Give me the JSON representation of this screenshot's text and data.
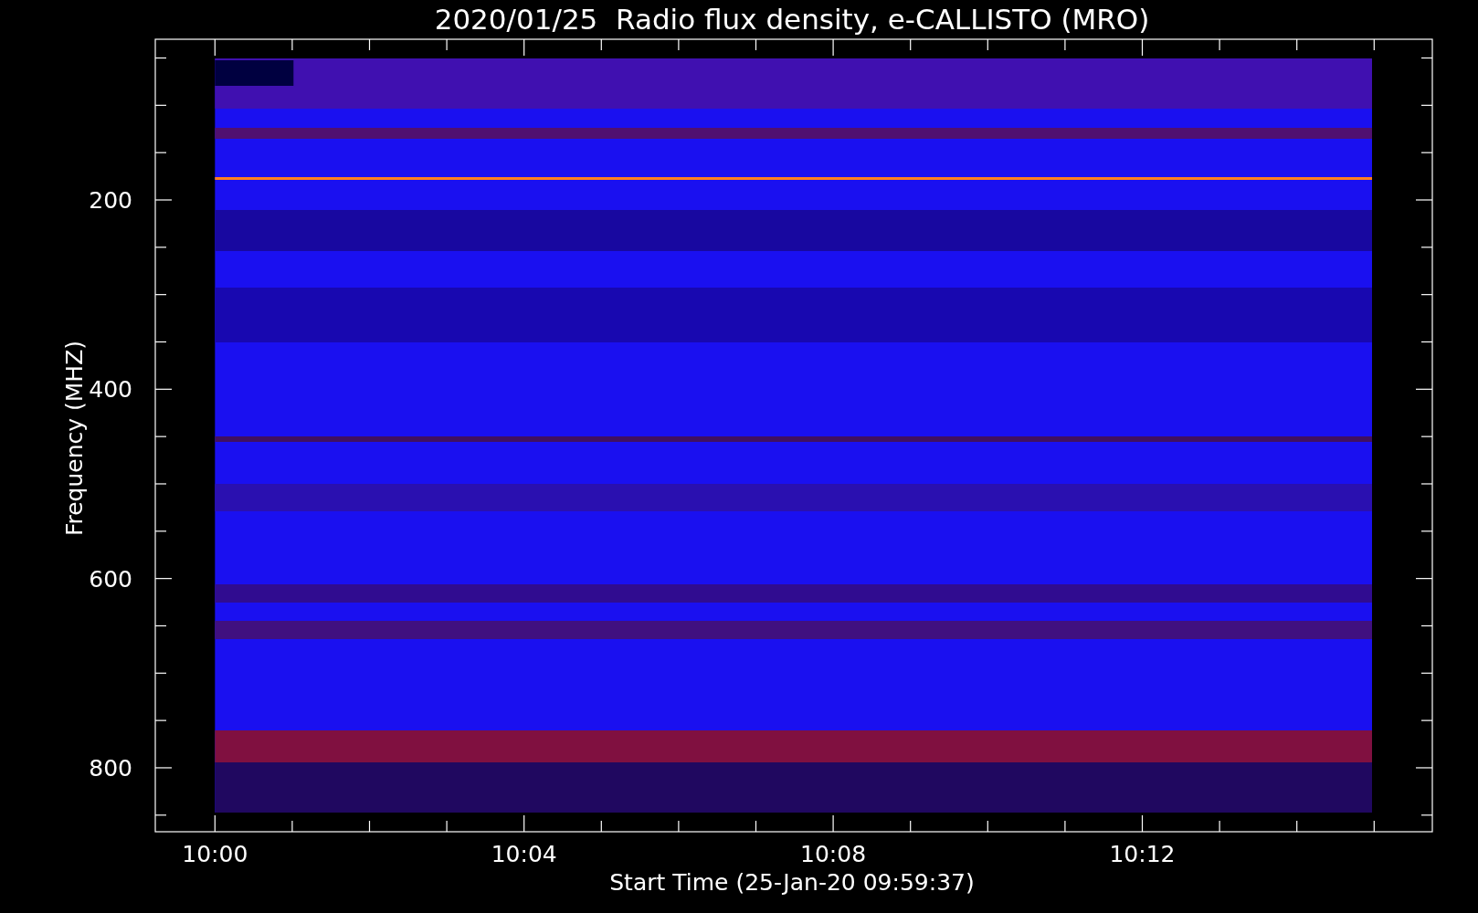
{
  "title": "2020/01/25  Radio flux density, e-CALLISTO (MRO)",
  "y_axis": {
    "label": "Frequency (MHZ)",
    "ticks": [
      "200",
      "400",
      "600",
      "800"
    ]
  },
  "x_axis": {
    "label": "Start Time (25-Jan-20 09:59:37)",
    "ticks": [
      "10:00",
      "10:04",
      "10:08",
      "10:12"
    ]
  }
}
